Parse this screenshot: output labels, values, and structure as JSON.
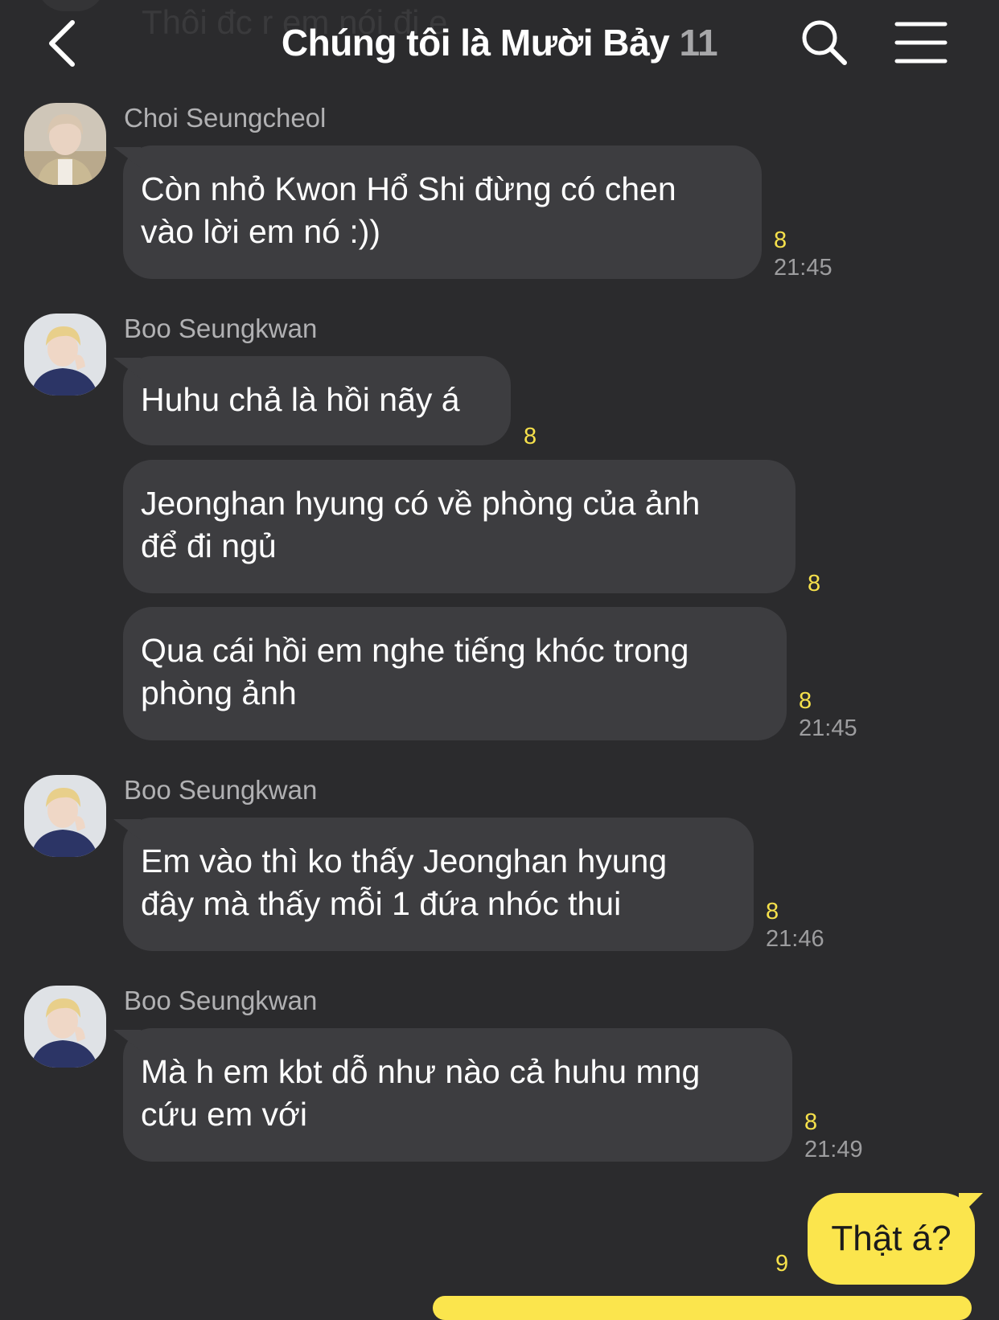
{
  "ghost_message": "Thôi đc r em nói đi e",
  "header": {
    "title": "Chúng tôi là Mười Bảy",
    "member_count": "11"
  },
  "icons": {
    "back": "chevron-left-icon",
    "search": "search-icon",
    "menu": "hamburger-menu-icon"
  },
  "colors": {
    "background": "#2b2b2d",
    "bubble_incoming": "#3d3d40",
    "bubble_outgoing": "#fbe54d",
    "unread_count": "#f5e04b",
    "timestamp": "#9d9d9f"
  },
  "messages": [
    {
      "sender": "Choi Seungcheol",
      "bubbles": [
        {
          "text": "Còn nhỏ Kwon Hổ Shi đừng có chen\nvào lời em nó :))",
          "unread": "8",
          "time": "21:45"
        }
      ]
    },
    {
      "sender": "Boo Seungkwan",
      "bubbles": [
        {
          "text": "Huhu chả là hồi nãy á",
          "unread": "8",
          "time": ""
        },
        {
          "text": "Jeonghan hyung có về phòng của ảnh\nđể đi ngủ",
          "unread": "8",
          "time": ""
        },
        {
          "text": "Qua cái hồi em nghe tiếng khóc trong\nphòng ảnh",
          "unread": "8",
          "time": "21:45"
        }
      ]
    },
    {
      "sender": "Boo Seungkwan",
      "bubbles": [
        {
          "text": "Em vào thì ko thấy Jeonghan hyung\nđây mà thấy mỗi 1 đứa nhóc thui",
          "unread": "8",
          "time": "21:46"
        }
      ]
    },
    {
      "sender": "Boo Seungkwan",
      "bubbles": [
        {
          "text": "Mà h em kbt dỗ như nào cả huhu mng\ncứu em với",
          "unread": "8",
          "time": "21:49"
        }
      ]
    }
  ],
  "my_message": {
    "text": "Thật á?",
    "unread": "9"
  }
}
